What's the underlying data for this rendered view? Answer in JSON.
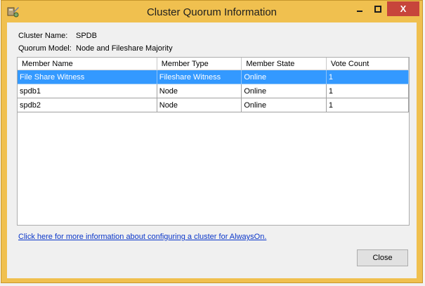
{
  "window": {
    "title": "Cluster Quorum Information",
    "close_glyph": "X"
  },
  "info": {
    "cluster_name_label": "Cluster Name:",
    "cluster_name_value": "SPDB",
    "quorum_model_label": "Quorum Model:",
    "quorum_model_value": "Node and Fileshare Majority"
  },
  "table": {
    "columns": [
      "Member Name",
      "Member Type",
      "Member State",
      "Vote Count"
    ],
    "rows": [
      [
        "File Share Witness",
        "Fileshare Witness",
        "Online",
        "1"
      ],
      [
        "spdb1",
        "Node",
        "Online",
        "1"
      ],
      [
        "spdb2",
        "Node",
        "Online",
        "1"
      ]
    ]
  },
  "link_text": "Click here for more information about configuring a cluster for AlwaysOn.",
  "close_button_label": "Close",
  "colors": {
    "frame": "#f0c04f",
    "selection": "#3399ff",
    "close_titlebar": "#c7453b",
    "link": "#0a36c9"
  }
}
